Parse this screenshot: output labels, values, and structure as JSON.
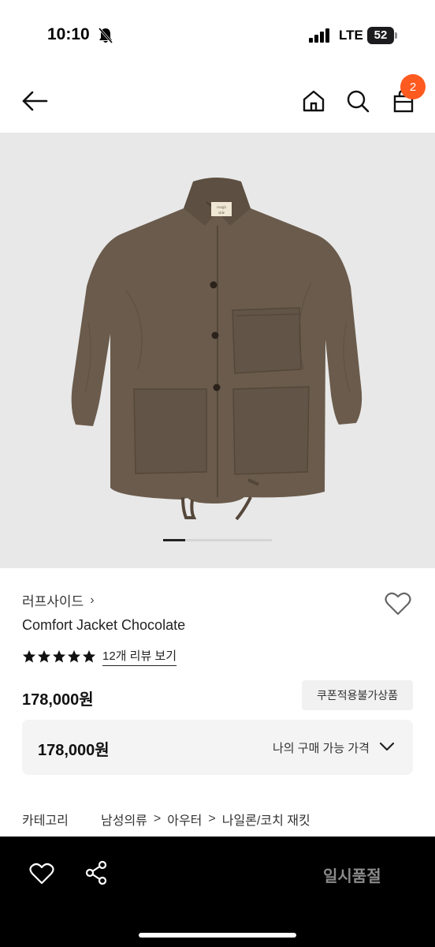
{
  "status_bar": {
    "time": "10:10",
    "network": "LTE",
    "battery": "52",
    "icons": [
      "bell-slash-icon",
      "signal-icon",
      "battery-icon"
    ]
  },
  "nav": {
    "icons": [
      "back-arrow-icon",
      "home-icon",
      "search-icon",
      "shopping-bag-icon"
    ],
    "cart_count": "2",
    "badge_color": "#ff5a1f"
  },
  "gallery": {
    "image_desc_icon": "jacket-photo",
    "current_index_fraction": 0.2
  },
  "product": {
    "brand": "러프사이드",
    "brand_chevron": "›",
    "name": "Comfort Jacket Chocolate",
    "rating": 5,
    "review_link": "12개 리뷰 보기",
    "price": "178,000원",
    "coupon_badge": "쿠폰적용불가상품",
    "my_price_value": "178,000원",
    "my_price_label": "나의 구매 가능 가격",
    "category_label": "카테고리",
    "category_path": [
      "남성의류",
      "아우터",
      "나일론/코치 재킷"
    ],
    "category_sep": ">"
  },
  "bottom_bar": {
    "sold_out_label": "일시품절",
    "icons": [
      "heart-icon",
      "share-icon"
    ]
  }
}
